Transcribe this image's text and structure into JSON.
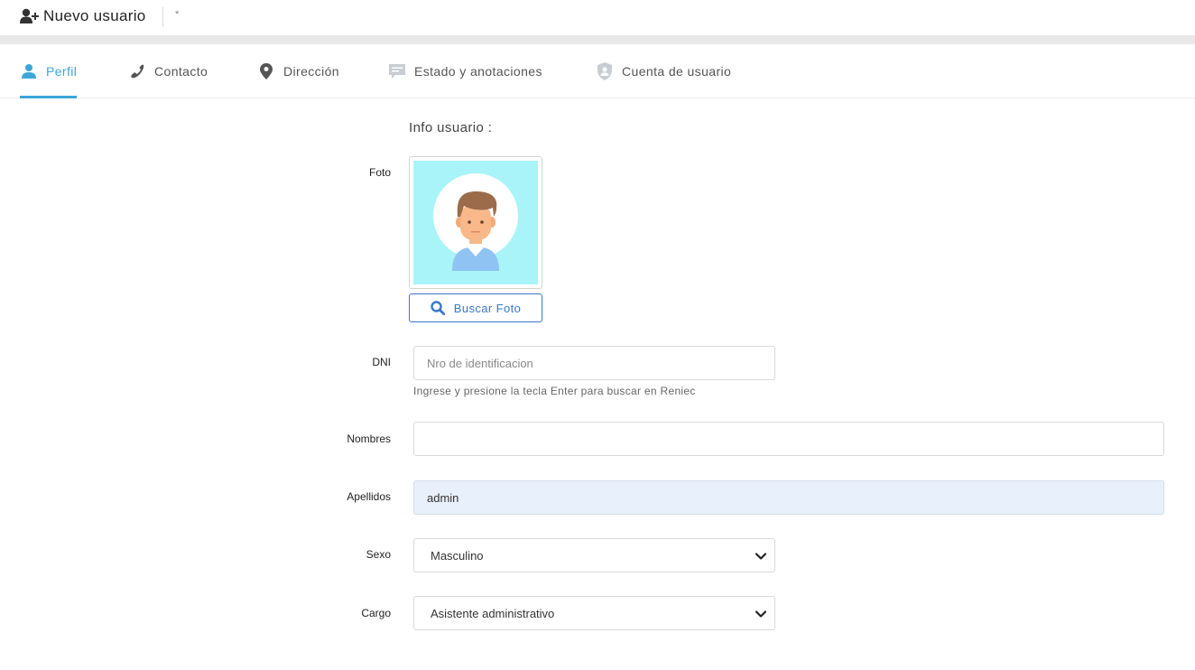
{
  "header": {
    "icon": "user-plus-icon",
    "title": "Nuevo usuario",
    "dirty_marker": "*"
  },
  "tabs": [
    {
      "label": "Perfil",
      "icon": "user-icon",
      "active": true
    },
    {
      "label": "Contacto",
      "icon": "phone-icon",
      "active": false
    },
    {
      "label": "Dirección",
      "icon": "map-pin-icon",
      "active": false
    },
    {
      "label": "Estado y anotaciones",
      "icon": "comment-icon",
      "active": false
    },
    {
      "label": "Cuenta de usuario",
      "icon": "shield-user-icon",
      "active": false
    }
  ],
  "form": {
    "section_title": "Info usuario :",
    "foto_label": "Foto",
    "buscar_foto_label": "Buscar Foto",
    "dni_label": "DNI",
    "dni_placeholder": "Nro de identificacion",
    "dni_value": "",
    "dni_help": "Ingrese y presione la tecla Enter para buscar en Reniec",
    "nombres_label": "Nombres",
    "nombres_value": "",
    "apellidos_label": "Apellidos",
    "apellidos_value": "admin",
    "sexo_label": "Sexo",
    "sexo_value": "Masculino",
    "cargo_label": "Cargo",
    "cargo_value": "Asistente administrativo"
  },
  "colors": {
    "accent": "#3aa7d8",
    "button": "#3a78c9",
    "autofill": "#e8f0fb",
    "avatar_bg": "#a8f4f8"
  }
}
